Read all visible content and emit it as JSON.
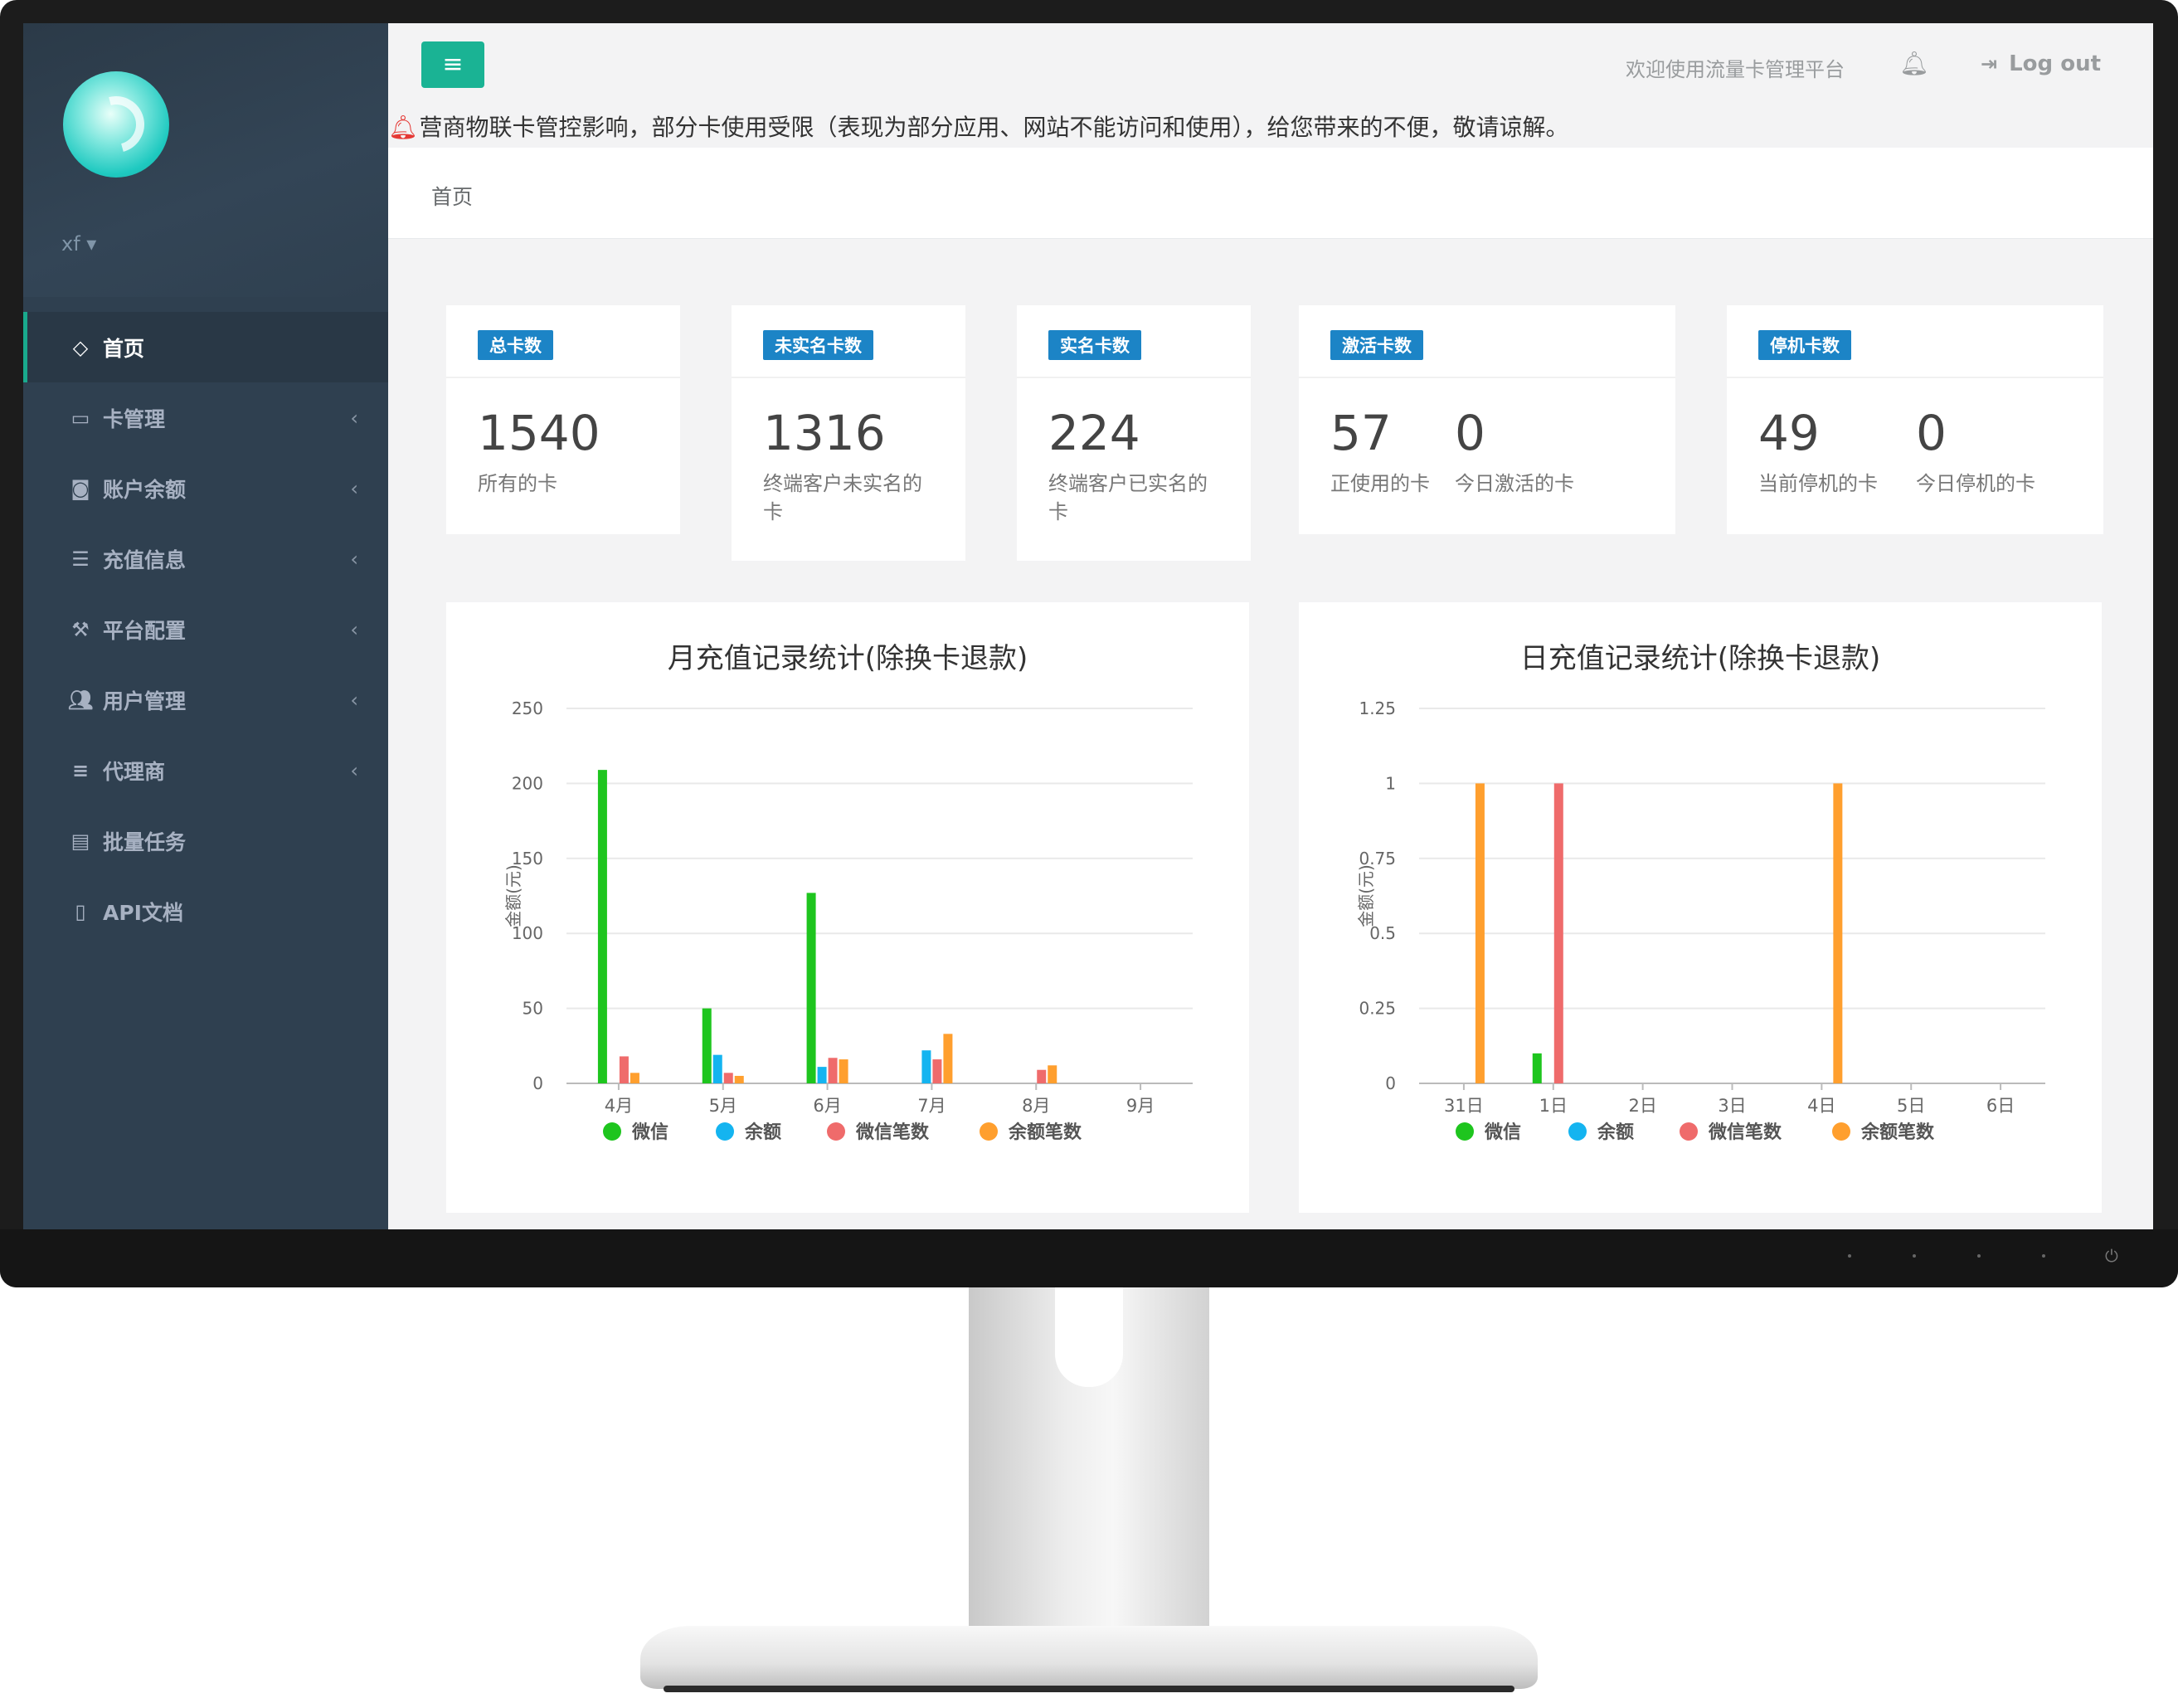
{
  "sidebar": {
    "user": "xf",
    "items": [
      {
        "label": "首页",
        "icon": "diamond-icon",
        "active": true,
        "arrow": ""
      },
      {
        "label": "卡管理",
        "icon": "credit-card-icon",
        "active": false,
        "arrow": "‹"
      },
      {
        "label": "账户余额",
        "icon": "money-icon",
        "active": false,
        "arrow": "‹"
      },
      {
        "label": "充值信息",
        "icon": "list-icon",
        "active": false,
        "arrow": "‹"
      },
      {
        "label": "平台配置",
        "icon": "wrench-icon",
        "active": false,
        "arrow": "‹"
      },
      {
        "label": "用户管理",
        "icon": "users-icon",
        "active": false,
        "arrow": "‹"
      },
      {
        "label": "代理商",
        "icon": "bars-icon",
        "active": false,
        "arrow": "‹"
      },
      {
        "label": "批量任务",
        "icon": "tasks-icon",
        "active": false,
        "arrow": ""
      },
      {
        "label": "API文档",
        "icon": "file-icon",
        "active": false,
        "arrow": ""
      }
    ]
  },
  "topbar": {
    "welcome": "欢迎使用流量卡管理平台",
    "logout": "Log out",
    "notice": "营商物联卡管控影响，部分卡使用受限（表现为部分应用、网站不能访问和使用），给您带来的不便，敬请谅解。"
  },
  "breadcrumb": "首页",
  "stats": [
    {
      "badge": "总卡数",
      "values": [
        {
          "num": "1540",
          "label": "所有的卡"
        }
      ]
    },
    {
      "badge": "未实名卡数",
      "values": [
        {
          "num": "1316",
          "label": "终端客户未实名的卡"
        }
      ]
    },
    {
      "badge": "实名卡数",
      "values": [
        {
          "num": "224",
          "label": "终端客户已实名的卡"
        }
      ]
    },
    {
      "badge": "激活卡数",
      "values": [
        {
          "num": "57",
          "label": "正使用的卡"
        },
        {
          "num": "0",
          "label": "今日激活的卡"
        }
      ]
    },
    {
      "badge": "停机卡数",
      "values": [
        {
          "num": "49",
          "label": "当前停机的卡"
        },
        {
          "num": "0",
          "label": "今日停机的卡"
        }
      ]
    }
  ],
  "colors": {
    "weixin": "#1ec51e",
    "yue": "#14b4f0",
    "weixin_count": "#ef6b6b",
    "yue_count": "#ff9f2e",
    "badge": "#1c84c6",
    "accent": "#1ab394"
  },
  "chart_data": [
    {
      "type": "bar",
      "title": "月充值记录统计(除换卡退款)",
      "ylabel": "金额(元)",
      "categories": [
        "4月",
        "5月",
        "6月",
        "7月",
        "8月",
        "9月"
      ],
      "ylim": [
        0,
        250
      ],
      "yticks": [
        "0",
        "50",
        "100",
        "150",
        "200",
        "250"
      ],
      "series": [
        {
          "name": "微信",
          "values": [
            209,
            50,
            127,
            0,
            0,
            0
          ]
        },
        {
          "name": "余额",
          "values": [
            0,
            19,
            11,
            22,
            0,
            0
          ]
        },
        {
          "name": "微信笔数",
          "values": [
            18,
            7,
            17,
            16,
            9,
            0
          ]
        },
        {
          "name": "余额笔数",
          "values": [
            7,
            5,
            16,
            33,
            12,
            0
          ]
        }
      ]
    },
    {
      "type": "bar",
      "title": "日充值记录统计(除换卡退款)",
      "ylabel": "金额(元)",
      "categories": [
        "31日",
        "1日",
        "2日",
        "3日",
        "4日",
        "5日",
        "6日"
      ],
      "ylim": [
        0,
        1.25
      ],
      "yticks": [
        "0",
        "0.25",
        "0.5",
        "0.75",
        "1",
        "1.25"
      ],
      "series": [
        {
          "name": "微信",
          "values": [
            0,
            0.1,
            0,
            0,
            0,
            0,
            0
          ]
        },
        {
          "name": "余额",
          "values": [
            0,
            0,
            0,
            0,
            0,
            0,
            0
          ]
        },
        {
          "name": "微信笔数",
          "values": [
            0,
            1,
            0,
            0,
            0,
            0,
            0
          ]
        },
        {
          "name": "余额笔数",
          "values": [
            1,
            0,
            0,
            0,
            1,
            0,
            0
          ]
        }
      ]
    }
  ]
}
